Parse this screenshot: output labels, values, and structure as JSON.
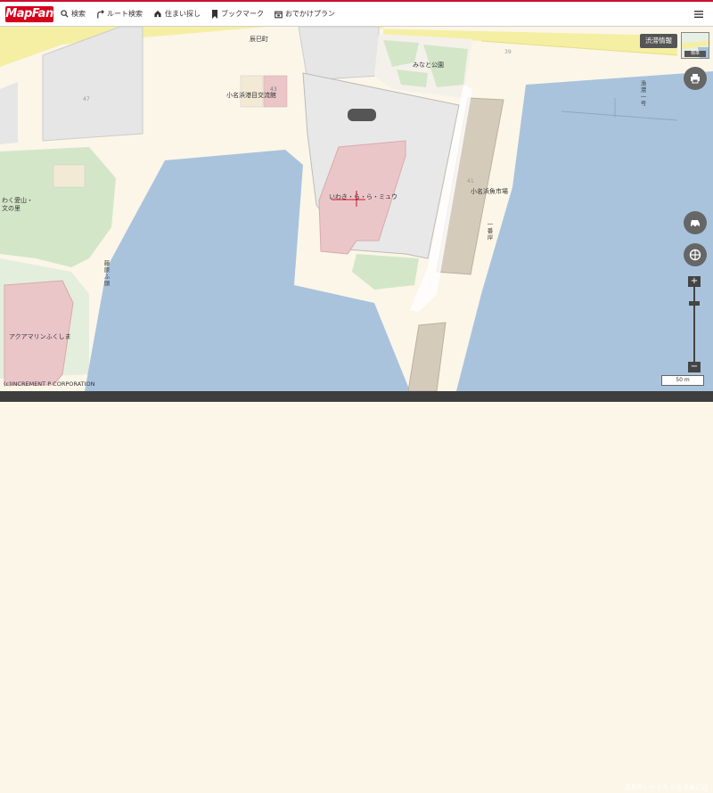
{
  "header": {
    "logo": "MapFan",
    "nav": [
      {
        "label": "検索",
        "icon": "search-icon"
      },
      {
        "label": "ルート検索",
        "icon": "route-icon"
      },
      {
        "label": "住まい探し",
        "icon": "house-icon"
      },
      {
        "label": "ブックマーク",
        "icon": "bookmark-icon"
      },
      {
        "label": "おでかけプラン",
        "icon": "calendar-icon"
      }
    ],
    "menu_icon": "hamburger-menu-icon"
  },
  "map": {
    "labels": {
      "area": "辰巳町",
      "building1": "小名浜港目交流館",
      "building1_num": "43",
      "block47": "47",
      "park": "みなと公園",
      "num39": "39",
      "facility": "いわき・ら・ら・ミュウ",
      "market": "小名浜魚市場",
      "num41": "41",
      "pier1": "漁港一号",
      "pier2": "一番岸",
      "quay": "藤原ふ頭",
      "left_label1": "わく愛山・",
      "left_label2": "文の里",
      "aquarium": "アクアマリンふくしま"
    },
    "colors": {
      "water": "#a9c3dd",
      "land": "#fbf6e8",
      "building": "#e8e8e8",
      "highlight_building": "#ebc6c8",
      "park": "#d4e6c8",
      "pier": "#d5cbbb",
      "road": "#f5efa4"
    }
  },
  "controls": {
    "traffic_button": "渋滞情報",
    "minimap_label": "標準",
    "print_icon": "printer-icon",
    "car_icon": "car-icon",
    "compass_icon": "compass-icon",
    "zoom_in": "+",
    "zoom_out": "−",
    "scale": "50 m"
  },
  "footer": {
    "copyright": "(c)INCREMENT P CORPORATION",
    "address": "福島県いわき市 小名浜辰巳町"
  }
}
